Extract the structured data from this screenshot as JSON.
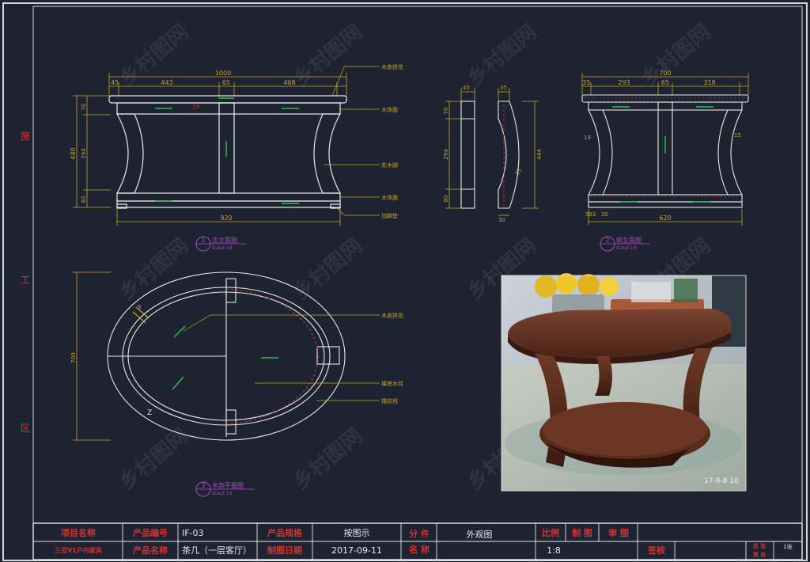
{
  "sheet": {
    "side_text": [
      "施",
      "工",
      "区"
    ]
  },
  "front_view": {
    "dims_top": [
      "1000",
      "45",
      "443",
      "65",
      "468"
    ],
    "dims_left": [
      "480",
      "70",
      "294",
      "80"
    ],
    "dim_bottom": "920",
    "dim_misc": "19",
    "notes": [
      "木皮拼花",
      "木饰面",
      "实木脚",
      "木饰面",
      "加脚垫"
    ],
    "view_no": "1",
    "view_title": "正立面图",
    "view_scale": "SCALE  1:8"
  },
  "section_view": {
    "dims_top": [
      "45",
      "35"
    ],
    "dims_left": [
      "70",
      "294",
      "80"
    ],
    "dim_right": "444",
    "dim_bottom": "30",
    "dim_curve": "35"
  },
  "side_view": {
    "dims_top": [
      "700",
      "35",
      "293",
      "65",
      "318"
    ],
    "dims_bottom": [
      "583",
      "20"
    ],
    "dim_bottom_total": "620",
    "dim_side_left": "19",
    "dim_side_right": "15",
    "view_no": "2",
    "view_title": "侧立面图",
    "view_scale": "SCALE  1:8"
  },
  "plan_view": {
    "dim_height": "700",
    "dim_corner": "9",
    "corner_mark": "Z",
    "notes": [
      "木皮拼花",
      "裸底木纹",
      "描纹线"
    ],
    "view_no": "3",
    "view_title": "半剖平面图",
    "view_scale": "SCALE  1:8"
  },
  "photo": {
    "stamp": "17-9-8  10"
  },
  "watermark_text": "乡村图网",
  "title_block": {
    "project_name_label": "项目名称",
    "project_name_value": "三亚V1户内家具",
    "product_code_label": "产品编号",
    "product_code_value": "IF-03",
    "product_name_label": "产品名称",
    "product_name_value": "茶几（一层客厅）",
    "spec_label": "产品规格",
    "spec_value": "按图示",
    "date_label": "制图日期",
    "date_value": "2017-09-11",
    "part_label_1": "分 件",
    "part_label_2": "名 称",
    "part_value": "外观图",
    "scale_label": "比例",
    "scale_value": "1:8",
    "drawn_label": "制 图",
    "review_label": "审 图",
    "sign_label": "签核",
    "sheet_label_1": "总 张",
    "sheet_label_2": "第 张",
    "sheet_value": "1张"
  }
}
